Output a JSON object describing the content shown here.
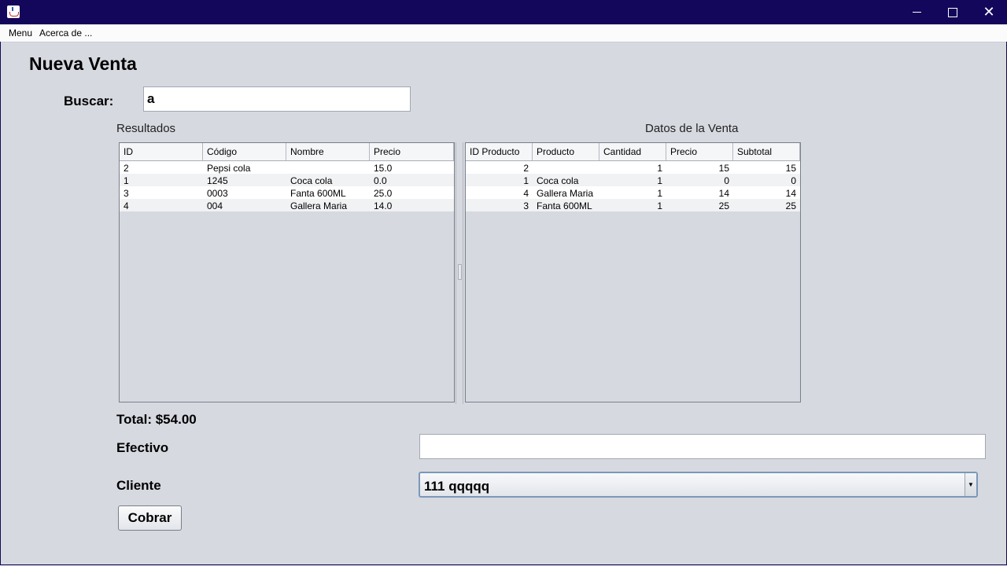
{
  "window": {
    "minimize_glyph": "",
    "close_glyph": "✕"
  },
  "menubar": {
    "items": [
      "Menu",
      "Acerca de ..."
    ]
  },
  "page": {
    "title": "Nueva Venta"
  },
  "search": {
    "label": "Buscar:",
    "value": "a"
  },
  "results": {
    "title": "Resultados",
    "columns": [
      "ID",
      "Código",
      "Nombre",
      "Precio"
    ],
    "rows": [
      [
        "2",
        "Pepsi cola",
        "",
        "15.0"
      ],
      [
        "1",
        "1245",
        "Coca cola",
        "0.0"
      ],
      [
        "3",
        "0003",
        "Fanta 600ML",
        "25.0"
      ],
      [
        "4",
        "004",
        "Gallera Maria",
        "14.0"
      ]
    ]
  },
  "sale": {
    "title": "Datos de la Venta",
    "columns": [
      "ID Producto",
      "Producto",
      "Cantidad",
      "Precio",
      "Subtotal"
    ],
    "rows": [
      [
        "2",
        "",
        "1",
        "15",
        "15"
      ],
      [
        "1",
        "Coca cola",
        "1",
        "0",
        "0"
      ],
      [
        "4",
        "Gallera Maria",
        "1",
        "14",
        "14"
      ],
      [
        "3",
        "Fanta 600ML",
        "1",
        "25",
        "25"
      ]
    ]
  },
  "footer": {
    "total": "Total: $54.00",
    "efectivo_label": "Efectivo",
    "efectivo_value": "",
    "cliente_label": "Cliente",
    "cliente_value": "111 qqqqq",
    "cobrar_label": "Cobrar"
  }
}
